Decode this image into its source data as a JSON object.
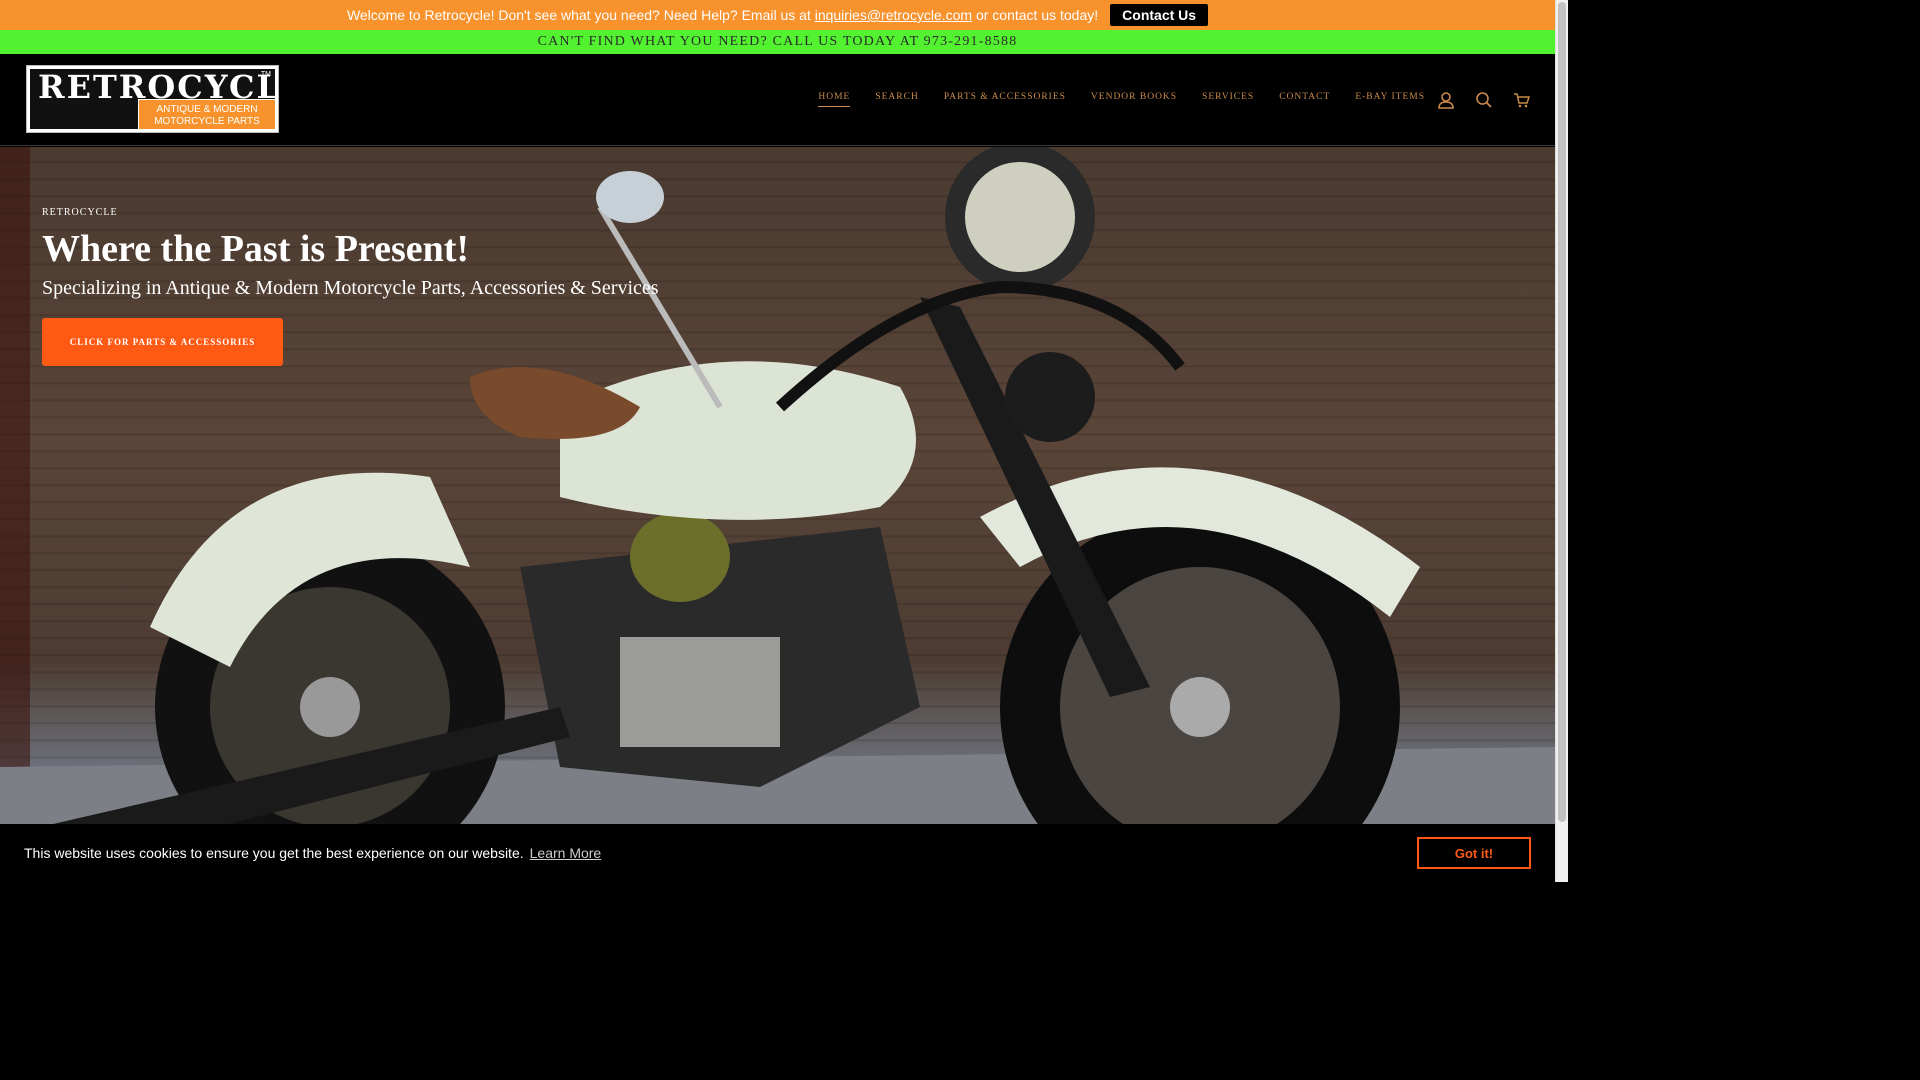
{
  "promo": {
    "text_before": "Welcome to Retrocycle!  Don't see what you need? Need Help? Email us at",
    "email": "inquiries@retrocycle.com",
    "text_after": "or contact us today!",
    "button_label": "Contact Us",
    "bg_color": "#f7922d"
  },
  "announcement": {
    "text": "CAN'T FIND WHAT YOU NEED? CALL US TODAY AT 973-291-8588",
    "bg_color": "#53f230"
  },
  "logo": {
    "word": "RETROCYCLE",
    "tm": "TM",
    "line1": "ANTIQUE & MODERN",
    "line2": "MOTORCYCLE PARTS"
  },
  "nav": {
    "items": [
      {
        "label": "HOME"
      },
      {
        "label": "SEARCH"
      },
      {
        "label": "PARTS & ACCESSORIES"
      },
      {
        "label": "VENDOR BOOKS"
      },
      {
        "label": "SERVICES"
      },
      {
        "label": "CONTACT"
      },
      {
        "label": "E-BAY ITEMS"
      }
    ],
    "icons": [
      "account-icon",
      "search-icon",
      "cart-icon"
    ],
    "color": "#c98a4b"
  },
  "hero": {
    "eyebrow": "RETROCYCLE",
    "title": "Where the Past is Present!",
    "subtitle": "Specializing in Antique & Modern Motorcycle Parts, Accessories & Services",
    "button_label": "CLICK FOR PARTS & ACCESSORIES",
    "button_color": "#ff5a14"
  },
  "cookie": {
    "message": "This website uses cookies to ensure you get the best experience on our website.",
    "link": "Learn More",
    "button_label": "Got it!"
  }
}
